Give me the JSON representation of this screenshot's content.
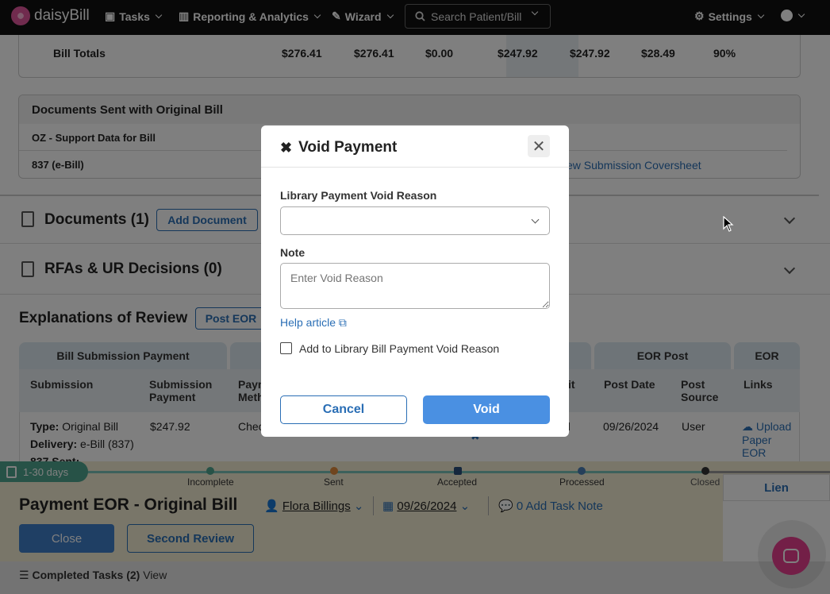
{
  "nav": {
    "brand": "daisyBill",
    "tasks": "Tasks",
    "reporting": "Reporting & Analytics",
    "wizard": "Wizard",
    "search_placeholder": "Search Patient/Bill",
    "settings": "Settings"
  },
  "bill_totals": {
    "label": "Bill Totals",
    "values": [
      "$276.41",
      "$276.41",
      "$0.00",
      "$247.92",
      "$247.92",
      "$28.49",
      "90%"
    ]
  },
  "documents_sent": {
    "title": "Documents Sent with Original Bill",
    "row1": "OZ - Support Data for Bill",
    "row2": "837 (e-Bill)",
    "link": "ew Submission Coversheet"
  },
  "documents": {
    "title": "Documents (1)",
    "add_button": "Add Document"
  },
  "rfas": {
    "title": "RFAs & UR Decisions (0)"
  },
  "eor": {
    "title": "Explanations of Review",
    "post_button": "Post EOR",
    "groups": [
      "Bill Submission Payment",
      "EOR Post",
      "EOR"
    ],
    "headers": [
      "Submission",
      "Submission Payment",
      "Paym Meth",
      "it",
      "Post Date",
      "Post Source",
      "Links"
    ],
    "row": {
      "type_label": "Type:",
      "type": "Original Bill",
      "delivery_label": "Delivery:",
      "delivery": "e-Bill (837)",
      "sent": "837 Sent:",
      "payment": "$247.92",
      "method": "Chec",
      "d": "d",
      "post_date": "09/26/2024",
      "post_source": "User",
      "link": "Upload Paper EOR"
    }
  },
  "task_bar": {
    "age": "1-30 days",
    "steps": [
      "Incomplete",
      "Sent",
      "Accepted",
      "Processed",
      "Closed"
    ],
    "title": "Payment EOR - Original Bill",
    "assignee": "Flora Billings",
    "date": "09/26/2024",
    "note": "0 Add Task Note",
    "close_button": "Close",
    "second_review_button": "Second Review",
    "lien": "Lien",
    "completed": "Completed Tasks (2)",
    "view": "View"
  },
  "modal": {
    "title": "Void Payment",
    "reason_label": "Library Payment Void Reason",
    "reason_value": "",
    "note_label": "Note",
    "note_placeholder": "Enter Void Reason",
    "help_link": "Help article",
    "checkbox_label": "Add to Library Bill Payment Void Reason",
    "cancel": "Cancel",
    "void": "Void"
  },
  "colors": {
    "primary": "#4a90e2",
    "link": "#2a6eb5",
    "chat": "#e63f8f"
  }
}
